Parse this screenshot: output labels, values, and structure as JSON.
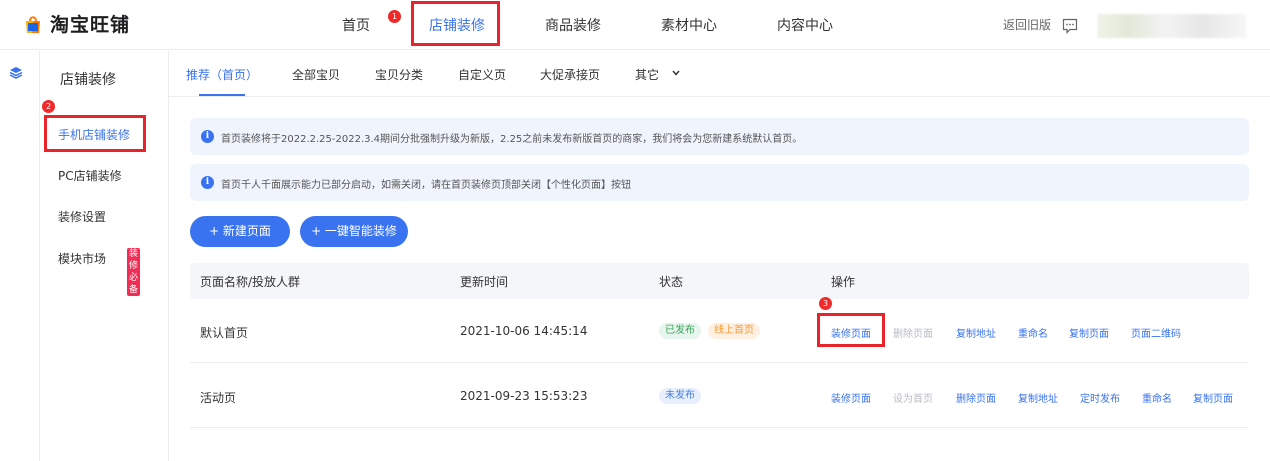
{
  "brand": {
    "name": "淘宝旺铺"
  },
  "topnav": {
    "items": [
      "首页",
      "店铺装修",
      "商品装修",
      "素材中心",
      "内容中心"
    ]
  },
  "header": {
    "return_old": "返回旧版"
  },
  "markers": {
    "m1": "1",
    "m2": "2",
    "m3": "3"
  },
  "sidebar": {
    "title": "店铺装修",
    "items": [
      {
        "label": "手机店铺装修"
      },
      {
        "label": "PC店铺装修"
      },
      {
        "label": "装修设置"
      },
      {
        "label": "模块市场",
        "badge": "装修必备"
      }
    ]
  },
  "tabs": {
    "items": [
      "推荐（首页）",
      "全部宝贝",
      "宝贝分类",
      "自定义页",
      "大促承接页",
      "其它"
    ]
  },
  "notices": [
    "首页装修将于2022.2.25-2022.3.4期间分批强制升级为新版，2.25之前未发布新版首页的商家，我们将会为您新建系统默认首页。",
    "首页千人千面展示能力已部分启动，如需关闭，请在首页装修页顶部关闭【个性化页面】按钮"
  ],
  "actions": {
    "new_page": "+ 新建页面",
    "smart_decorate": "+ 一键智能装修"
  },
  "table": {
    "headers": [
      "页面名称/投放人群",
      "更新时间",
      "状态",
      "操作"
    ],
    "rows": [
      {
        "name": "默认首页",
        "time": "2021-10-06 14:45:14",
        "tags": [
          "已发布",
          "线上首页"
        ],
        "ops": [
          "装修页面",
          "删除页面",
          "复制地址",
          "重命名",
          "复制页面",
          "页面二维码"
        ]
      },
      {
        "name": "活动页",
        "time": "2021-09-23 15:53:23",
        "tags": [
          "未发布"
        ],
        "ops": [
          "装修页面",
          "设为首页",
          "删除页面",
          "复制地址",
          "定时发布",
          "重命名",
          "复制页面"
        ]
      }
    ]
  },
  "colors": {
    "accent": "#3a73f0",
    "highlight": "#e8242a",
    "marker": "#f0292b"
  }
}
